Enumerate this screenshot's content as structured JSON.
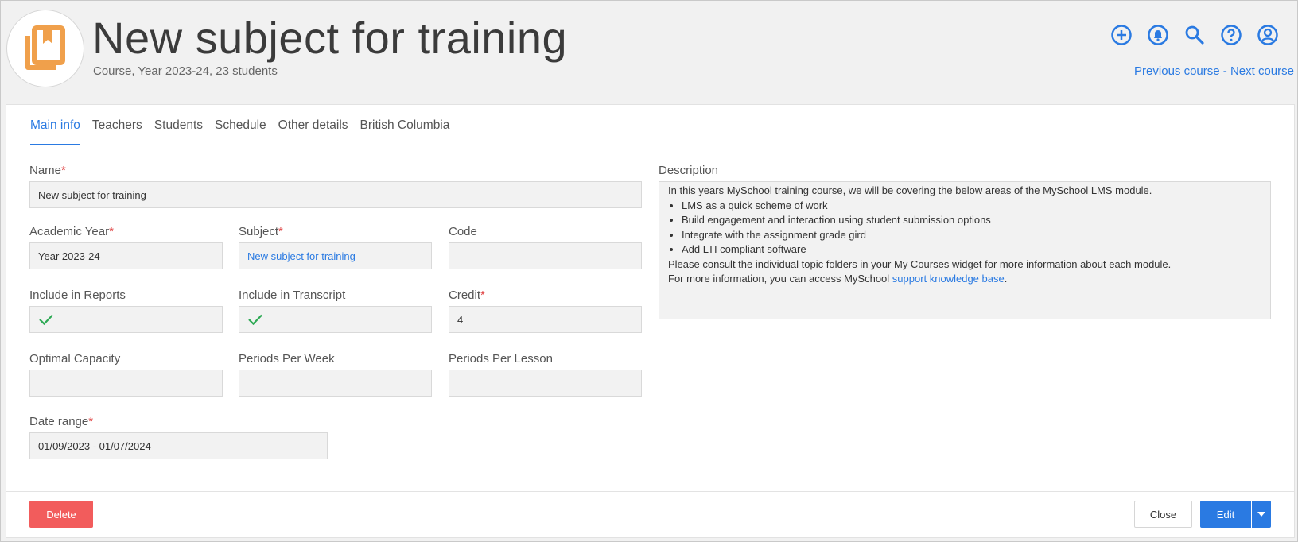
{
  "header": {
    "title": "New subject for training",
    "subtitle": "Course, Year 2023-24, 23 students",
    "prev_label": "Previous course",
    "separator": " - ",
    "next_label": "Next course",
    "icons": [
      "add-circle-icon",
      "bell-icon",
      "search-icon",
      "help-icon",
      "account-icon"
    ],
    "accent": "#2a7ae2",
    "logo_color": "#f0a04b"
  },
  "tabs": [
    {
      "label": "Main info",
      "active": true
    },
    {
      "label": "Teachers"
    },
    {
      "label": "Students"
    },
    {
      "label": "Schedule"
    },
    {
      "label": "Other details"
    },
    {
      "label": "British Columbia"
    }
  ],
  "form": {
    "name": {
      "label": "Name",
      "required": "*",
      "value": "New subject for training"
    },
    "academic_year": {
      "label": "Academic Year",
      "required": "*",
      "value": "Year 2023-24"
    },
    "subject": {
      "label": "Subject",
      "required": "*",
      "value": "New subject for training"
    },
    "code": {
      "label": "Code",
      "value": ""
    },
    "include_reports": {
      "label": "Include in Reports",
      "checked": true
    },
    "include_transcript": {
      "label": "Include in Transcript",
      "checked": true
    },
    "credit": {
      "label": "Credit",
      "required": "*",
      "value": "4"
    },
    "optimal_capacity": {
      "label": "Optimal Capacity",
      "value": ""
    },
    "periods_week": {
      "label": "Periods Per Week",
      "value": ""
    },
    "periods_lesson": {
      "label": "Periods Per Lesson",
      "value": ""
    },
    "date_range": {
      "label": "Date range",
      "required": "*",
      "value": "01/09/2023 - 01/07/2024"
    }
  },
  "description": {
    "label": "Description",
    "intro": "In this years MySchool training course, we will be covering the below areas of the MySchool LMS module.",
    "bullets": [
      "LMS as a quick scheme of work",
      "Build engagement and interaction using student submission options",
      "Integrate with the assignment grade gird",
      "Add LTI compliant software"
    ],
    "line2": "Please consult the individual topic folders in your My Courses widget for more information about each module.",
    "line3_prefix": "For more information, you can access MySchool ",
    "line3_link": "support knowledge base",
    "line3_suffix": "."
  },
  "footer": {
    "delete_label": "Delete",
    "close_label": "Close",
    "edit_label": "Edit",
    "delete_color": "#f25c5c",
    "check_color": "#2eaa55"
  }
}
